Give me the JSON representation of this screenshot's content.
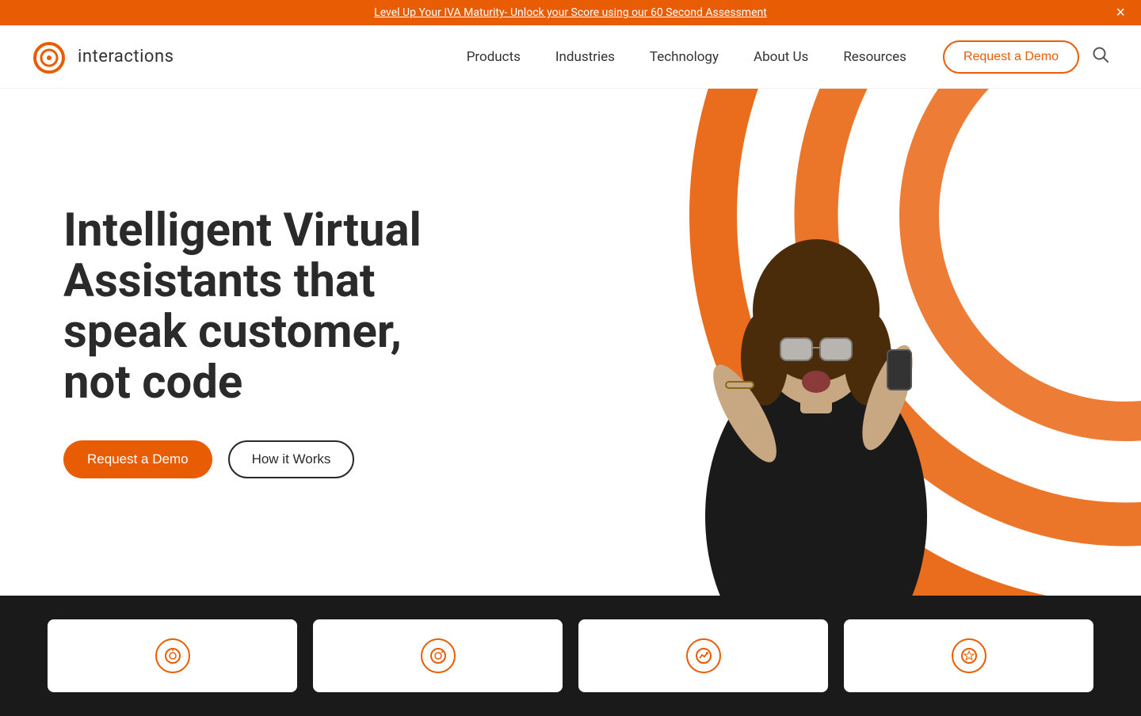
{
  "banner": {
    "text": "Level Up Your IVA Maturity- Unlock your Score using our 60 Second Assessment",
    "close_label": "×"
  },
  "navbar": {
    "logo_text": "interactions",
    "nav_items": [
      {
        "label": "Products",
        "id": "products"
      },
      {
        "label": "Industries",
        "id": "industries"
      },
      {
        "label": "Technology",
        "id": "technology"
      },
      {
        "label": "About Us",
        "id": "about-us"
      },
      {
        "label": "Resources",
        "id": "resources"
      }
    ],
    "cta_label": "Request a Demo",
    "search_icon": "🔍"
  },
  "hero": {
    "headline": "Intelligent Virtual Assistants that speak customer, not code",
    "cta_primary": "Request a Demo",
    "cta_secondary": "How it Works"
  },
  "bottom_cards": [
    {
      "icon": "💬"
    },
    {
      "icon": "🎯"
    },
    {
      "icon": "📈"
    },
    {
      "icon": "⭐"
    }
  ],
  "colors": {
    "orange": "#e85d04",
    "dark": "#1a1a1a",
    "text": "#2a2a2a"
  }
}
